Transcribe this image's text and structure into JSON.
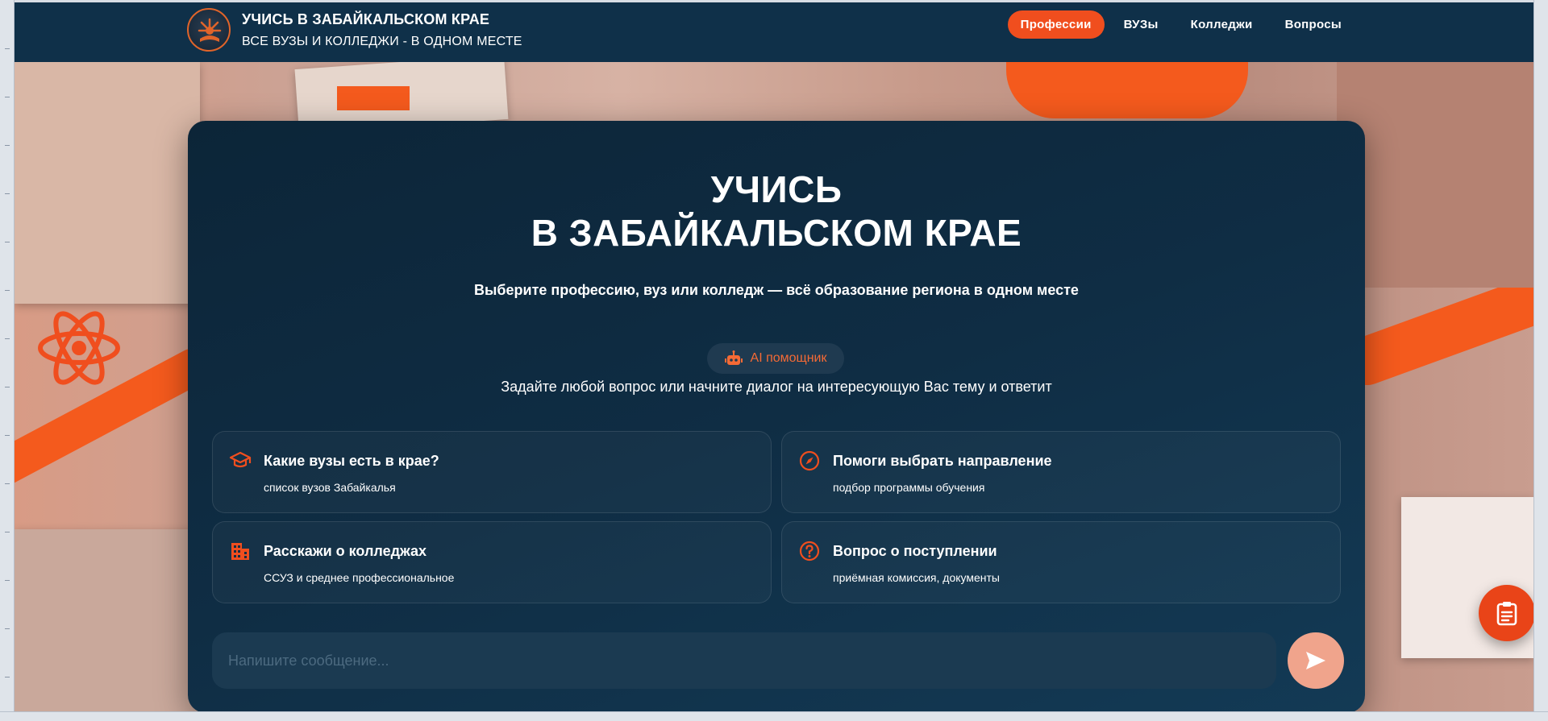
{
  "header": {
    "title": "УЧИСЬ В ЗАБАЙКАЛЬСКОМ КРАЕ",
    "subtitle": "ВСЕ ВУЗЫ И КОЛЛЕДЖИ - В ОДНОМ МЕСТЕ"
  },
  "nav": {
    "items": [
      {
        "label": "Профессии",
        "active": true
      },
      {
        "label": "ВУЗы",
        "active": false
      },
      {
        "label": "Колледжи",
        "active": false
      },
      {
        "label": "Вопросы",
        "active": false
      }
    ]
  },
  "hero": {
    "title_line1": "УЧИСЬ",
    "title_line2": "В ЗАБАЙКАЛЬСКОМ КРАЕ",
    "subtitle": "Выберите профессию, вуз или колледж — всё образование региона в одном месте"
  },
  "assistant": {
    "badge_label": "AI помощник",
    "badge_icon": "robot-icon",
    "description": "Задайте любой вопрос или начните диалог на интересующую Вас тему и ответит"
  },
  "suggestions": [
    {
      "title": "Какие вузы есть в крае?",
      "subtitle": "список вузов Забайкалья",
      "icon": "graduation-cap-icon"
    },
    {
      "title": "Помоги выбрать направление",
      "subtitle": "подбор программы обучения",
      "icon": "compass-icon"
    },
    {
      "title": "Расскажи о колледжах",
      "subtitle": "ССУЗ и среднее профессиональное",
      "icon": "building-icon"
    },
    {
      "title": "Вопрос о поступлении",
      "subtitle": "приёмная комиссия, документы",
      "icon": "question-circle-icon"
    }
  ],
  "chat": {
    "placeholder": "Напишите сообщение...",
    "send_icon": "send-icon"
  },
  "fab": {
    "icon": "clipboard-icon"
  },
  "colors": {
    "header_bg": "#0f3049",
    "accent": "#f04e1e",
    "card_bg": "#0f2d44",
    "send_button": "#f0a48c"
  }
}
